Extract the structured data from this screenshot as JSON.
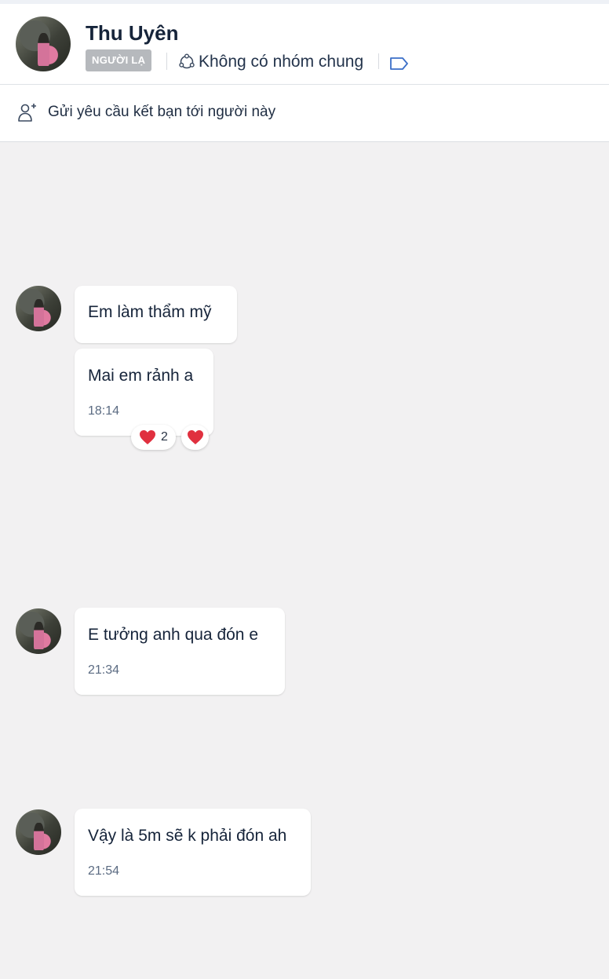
{
  "header": {
    "name": "Thu Uyên",
    "badge": "NGƯỜI LẠ",
    "groups_text": "Không có nhóm chung"
  },
  "friend_request": {
    "label": "Gửi yêu cầu kết bạn tới người này"
  },
  "messages": [
    {
      "text": "Em làm thẩm mỹ"
    },
    {
      "text": "Mai em rảnh a",
      "time": "18:14",
      "reactions": [
        {
          "icon": "heart-emoji",
          "count": "2"
        },
        {
          "icon": "heart-emoji"
        }
      ]
    },
    {
      "text": " E tưởng anh qua đón e",
      "time": "21:34"
    },
    {
      "text": "Vậy là 5m sẽ k phải đón ah",
      "time": "21:54"
    }
  ],
  "colors": {
    "background": "#f2f1f2",
    "badge": "#b6b9bd",
    "heart": "#e0303f",
    "text": "#16243a",
    "time": "#5b6b82"
  }
}
